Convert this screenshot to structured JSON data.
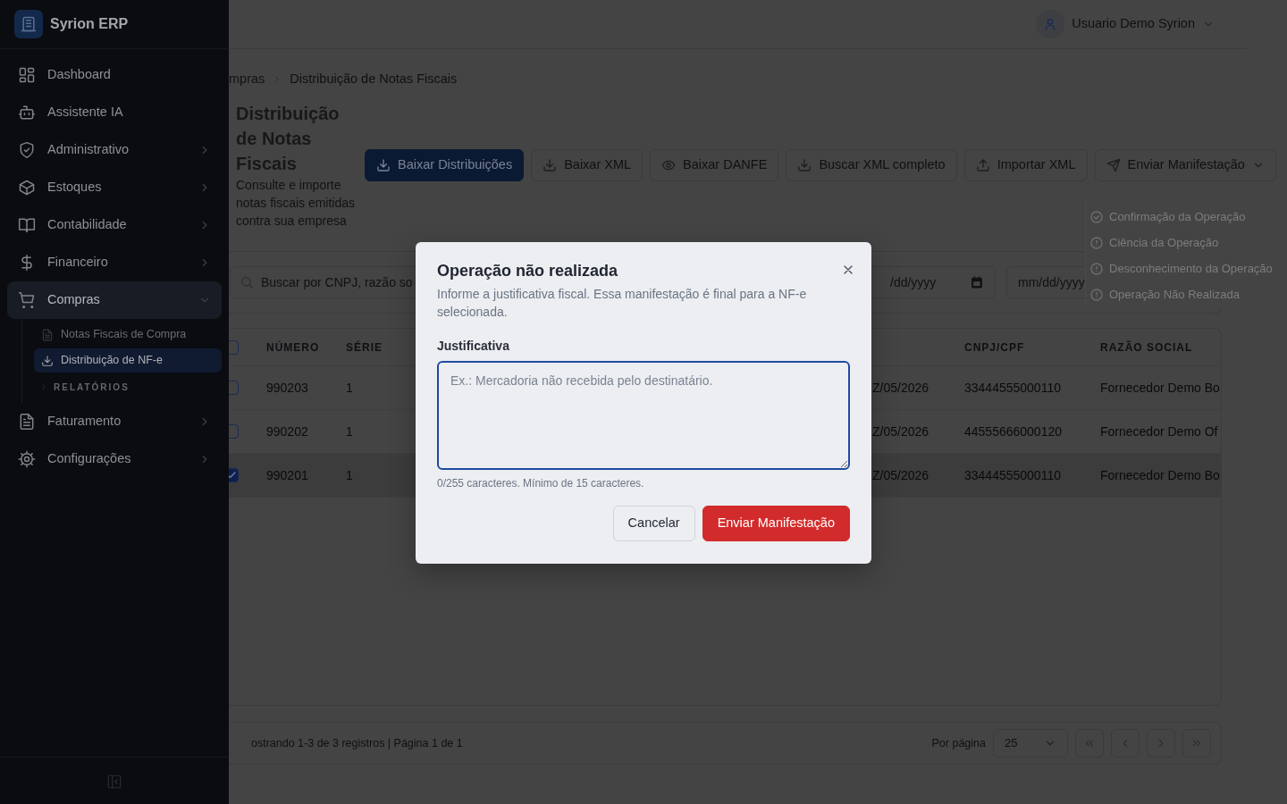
{
  "sidebar": {
    "brand": "Syrion ERP",
    "items": [
      {
        "kind": "link",
        "label": "Dashboard",
        "selected": false
      },
      {
        "kind": "link",
        "label": "Assistente IA",
        "selected": false
      },
      {
        "kind": "group",
        "label": "Administrativo",
        "selected": false,
        "expanded": false
      },
      {
        "kind": "group",
        "label": "Estoques",
        "selected": false,
        "expanded": false
      },
      {
        "kind": "group",
        "label": "Contabilidade",
        "selected": false,
        "expanded": false
      },
      {
        "kind": "group",
        "label": "Financeiro",
        "selected": false,
        "expanded": false
      },
      {
        "kind": "group",
        "label": "Compras",
        "selected": true,
        "expanded": true,
        "children": [
          {
            "kind": "link",
            "label": "Notas Fiscais de Compra",
            "selected": false
          },
          {
            "kind": "link",
            "label": "Distribuição de NF-e",
            "selected": true
          },
          {
            "kind": "section",
            "label": "RELATÓRIOS",
            "expanded": false
          }
        ]
      },
      {
        "kind": "group",
        "label": "Faturamento",
        "selected": false,
        "expanded": false
      },
      {
        "kind": "group",
        "label": "Configurações",
        "selected": false,
        "expanded": false
      }
    ]
  },
  "header": {
    "user": "Usuario Demo Syrion"
  },
  "breadcrumb": [
    "mpras",
    "Distribuição de Notas Fiscais"
  ],
  "page": {
    "title": "Distribuição de Notas Fiscais",
    "subtitle": "Consulte e importe notas fiscais emitidas contra sua empresa"
  },
  "toolbar": [
    {
      "label": "Baixar Distribuições",
      "kind": "primary"
    },
    {
      "label": "Baixar XML",
      "kind": "outline"
    },
    {
      "label": "Baixar DANFE",
      "kind": "outline"
    },
    {
      "label": "Buscar XML completo",
      "kind": "outline"
    },
    {
      "label": "Importar XML",
      "kind": "outline"
    },
    {
      "label": "Enviar Manifestação",
      "kind": "dropdown"
    }
  ],
  "manifest_menu": {
    "items": [
      "Confirmação da Operação",
      "Ciência da Operação",
      "Desconhecimento da Operação",
      "Operação Não Realizada"
    ]
  },
  "filters": {
    "search": {
      "placeholder": "Buscar por CNPJ, razão so"
    },
    "date_from": {
      "placeholder": "/dd/yyyy"
    },
    "date_to": {
      "placeholder": "mm/dd/yyyy"
    }
  },
  "table": {
    "header": {
      "checked": false,
      "numero": "NÚMERO",
      "serie": "SÉRIE",
      "cnpj_cpf": "CNPJ/CPF",
      "razao_social": "RAZÃO SOCIAL"
    },
    "rows": [
      {
        "selected": false,
        "numero": "990203",
        "serie": "1",
        "date": "Z/05/2026",
        "cnpj_cpf": "33444555000110",
        "razao_social": "Fornecedor Demo Bo"
      },
      {
        "selected": false,
        "numero": "990202",
        "serie": "1",
        "date": "Z/05/2026",
        "cnpj_cpf": "44555666000120",
        "razao_social": "Fornecedor Demo Of"
      },
      {
        "selected": true,
        "numero": "990201",
        "serie": "1",
        "date": "Z/05/2026",
        "cnpj_cpf": "33444555000110",
        "razao_social": "Fornecedor Demo Bo"
      }
    ]
  },
  "footer": {
    "summary": "ostrando 1-3 de 3 registros | Página 1 de 1",
    "per_page_label": "Por página",
    "per_page": "25"
  },
  "modal": {
    "title": "Operação não realizada",
    "description": "Informe a justificativa fiscal. Essa manifestação é final para a NF-e selecionada.",
    "field_label": "Justificativa",
    "placeholder": "Ex.: Mercadoria não recebida pelo destinatário.",
    "helper": "0/255 caracteres. Mínimo de 15 caracteres.",
    "buttons": [
      {
        "label": "Cancelar",
        "kind": "secondary"
      },
      {
        "label": "Enviar Manifestação",
        "kind": "danger"
      }
    ]
  }
}
